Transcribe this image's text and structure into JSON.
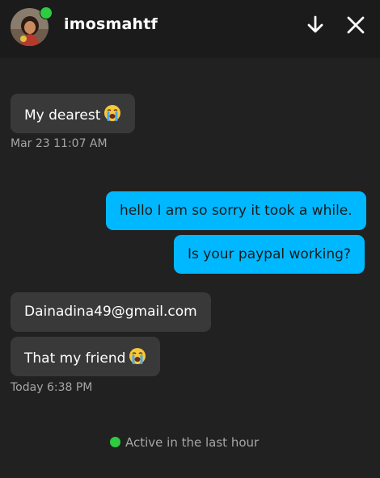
{
  "header": {
    "username": "imosmahtf",
    "online": true
  },
  "messages": [
    {
      "text": "My dearest",
      "emoji": "loudly-crying-face-emoji",
      "direction": "incoming"
    },
    {
      "text": "hello I am so sorry it took a while.",
      "direction": "outgoing"
    },
    {
      "text": "Is your paypal working?",
      "direction": "outgoing"
    },
    {
      "text": "Dainadina49@gmail.com",
      "direction": "incoming"
    },
    {
      "text": "That my friend",
      "emoji": "loudly-crying-face-emoji",
      "direction": "incoming"
    }
  ],
  "timestamps": {
    "first": "Mar 23 11:07 AM",
    "second": "Today 6:38 PM"
  },
  "status": {
    "active_text": "Active in the last hour"
  },
  "colors": {
    "background": "#212121",
    "incoming_bubble": "#393939",
    "outgoing_bubble": "#00b8ff",
    "online": "#2ecc40"
  },
  "icons": {
    "down": "arrow-down-icon",
    "close": "close-icon"
  }
}
